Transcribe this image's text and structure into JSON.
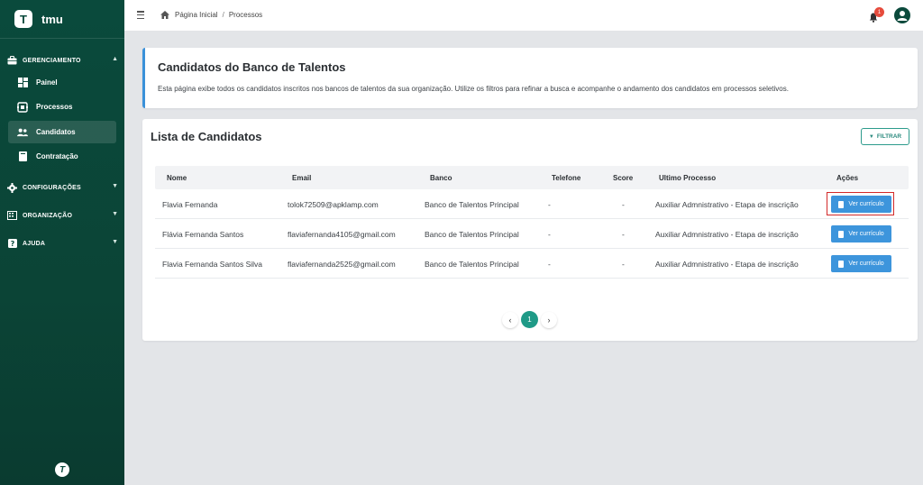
{
  "brand": {
    "initial": "T",
    "name": "tmu"
  },
  "sidebar": {
    "sections": [
      {
        "label": "GERENCIAMENTO",
        "icon": "briefcase-icon"
      },
      {
        "label": "CONFIGURAÇÕES",
        "icon": "gear-icon"
      },
      {
        "label": "ORGANIZAÇÃO",
        "icon": "building-icon"
      },
      {
        "label": "AJUDA",
        "icon": "help-icon"
      }
    ],
    "items": [
      {
        "label": "Painel",
        "icon": "dashboard-icon"
      },
      {
        "label": "Processos",
        "icon": "processes-icon"
      },
      {
        "label": "Candidatos",
        "icon": "users-icon"
      },
      {
        "label": "Contratação",
        "icon": "document-icon"
      }
    ],
    "footer_logo": "T"
  },
  "topbar": {
    "breadcrumb": {
      "home": "Página Inicial",
      "sep": "/",
      "current": "Processos"
    },
    "notifications_count": "1"
  },
  "info": {
    "title": "Candidatos do Banco de Talentos",
    "description": "Esta página exibe todos os candidatos inscritos nos bancos de talentos da sua organização. Utilize os filtros para refinar a busca e acompanhe o andamento dos candidatos em processos seletivos."
  },
  "list": {
    "title": "Lista de Candidatos",
    "filter_label": "FILTRAR",
    "columns": {
      "nome": "Nome",
      "email": "Email",
      "banco": "Banco",
      "telefone": "Telefone",
      "score": "Score",
      "processo": "Ultimo Processo",
      "acoes": "Ações"
    },
    "rows": [
      {
        "nome": "Flavia Fernanda",
        "email": "tolok72509@apklamp.com",
        "banco": "Banco de Talentos Principal",
        "telefone": "-",
        "score": "-",
        "processo": "Auxiliar Admnistrativo - Etapa de inscrição",
        "action": "Ver currículo"
      },
      {
        "nome": "Flávia Fernanda Santos",
        "email": "flaviafernanda4105@gmail.com",
        "banco": "Banco de Talentos Principal",
        "telefone": "-",
        "score": "-",
        "processo": "Auxiliar Admnistrativo - Etapa de inscrição",
        "action": "Ver currículo"
      },
      {
        "nome": "Flavia Fernanda Santos Silva",
        "email": "flaviafernanda2525@gmail.com",
        "banco": "Banco de Talentos Principal",
        "telefone": "-",
        "score": "-",
        "processo": "Auxiliar Admnistrativo - Etapa de inscrição",
        "action": "Ver currículo"
      }
    ],
    "pagination": {
      "current": "1",
      "prev": "‹",
      "next": "›"
    }
  },
  "colors": {
    "sidebar": "#0a4a3c",
    "accent": "#1f9a87",
    "primary_button": "#3d95dc",
    "highlight": "#d32a2a",
    "badge": "#e64b3c"
  }
}
